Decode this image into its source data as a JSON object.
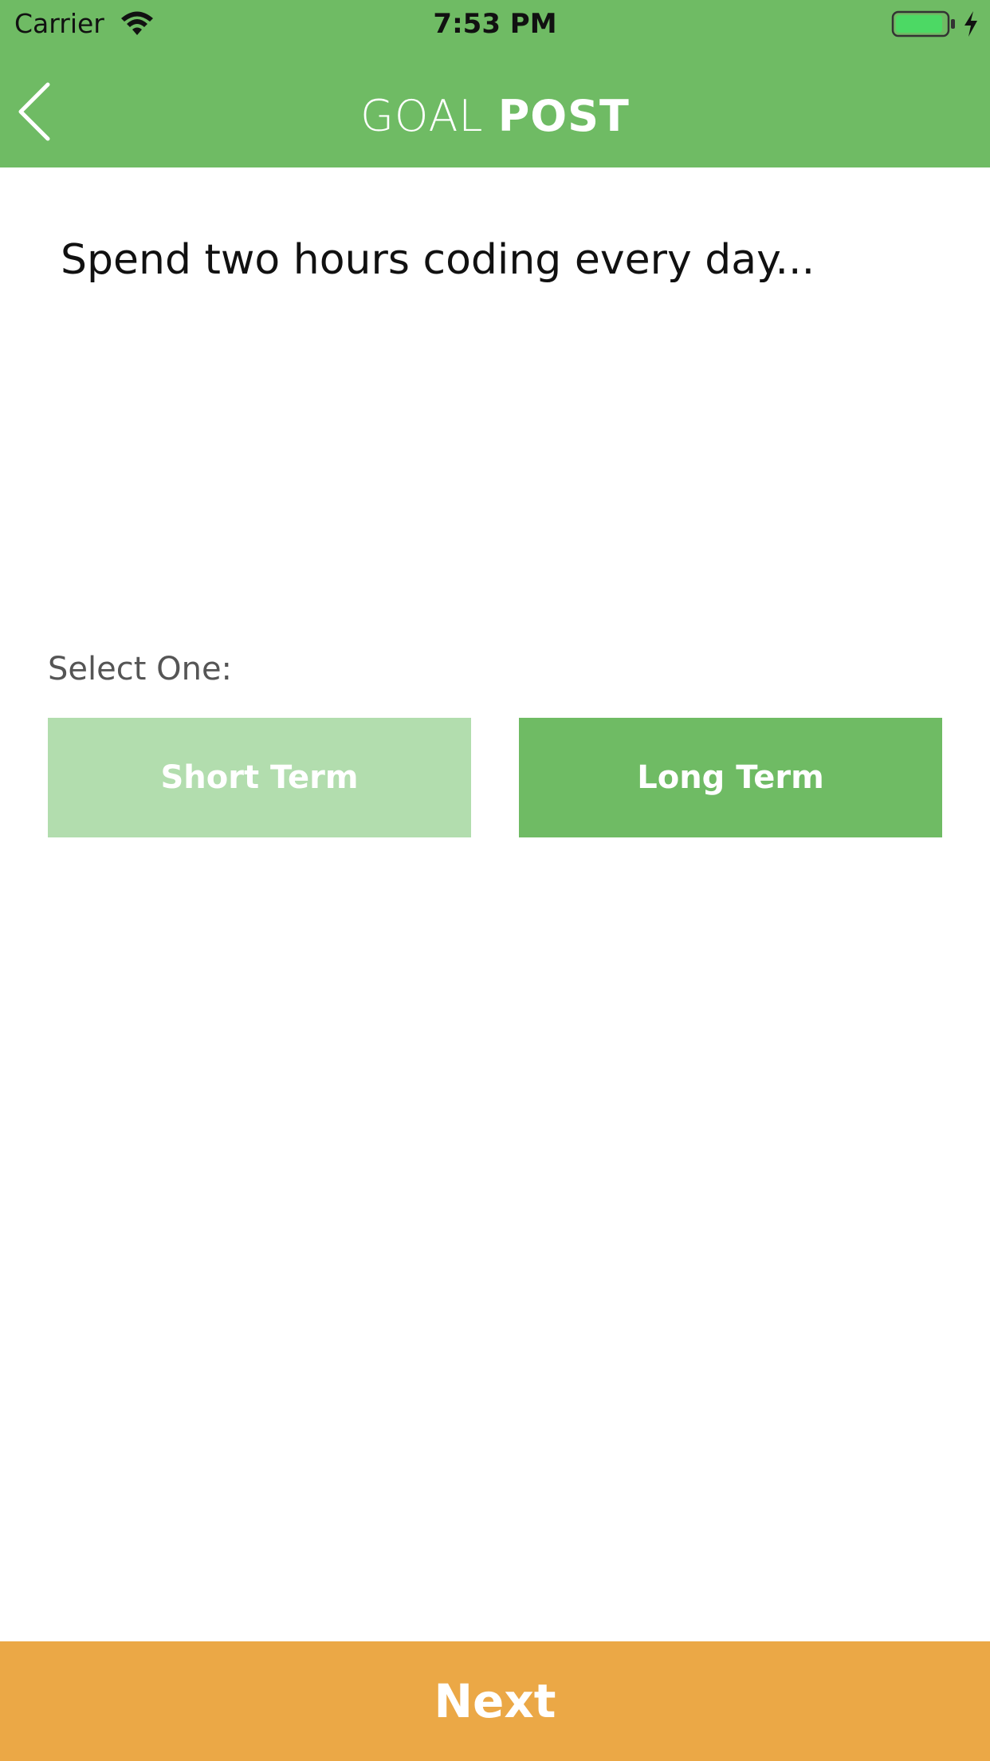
{
  "status_bar": {
    "carrier": "Carrier",
    "time": "7:53 PM"
  },
  "nav": {
    "title_light": "GOAL",
    "title_bold": "POST",
    "back_icon": "chevron-left-icon"
  },
  "goal": {
    "text": "Spend two hours coding every day..."
  },
  "selection": {
    "label": "Select One:",
    "options": [
      {
        "label": "Short Term",
        "selected": false
      },
      {
        "label": "Long Term",
        "selected": true
      }
    ]
  },
  "footer": {
    "next_label": "Next"
  },
  "colors": {
    "header_green": "#6fbb64",
    "selected_green": "#6fbb64",
    "unselected_green": "#b2ddae",
    "next_orange": "#eba846"
  }
}
